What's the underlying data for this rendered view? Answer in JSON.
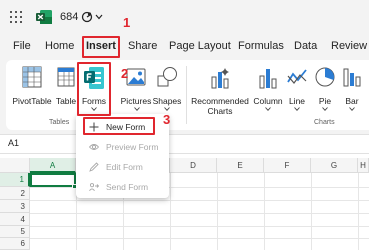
{
  "titlebar": {
    "doc_name": "684"
  },
  "tabs": [
    "File",
    "Home",
    "Insert",
    "Share",
    "Page Layout",
    "Formulas",
    "Data",
    "Review"
  ],
  "ribbon": {
    "pivottable": "PivotTable",
    "table": "Table",
    "forms": "Forms",
    "pictures": "Pictures",
    "shapes": "Shapes",
    "recommended_charts_1": "Recommended",
    "recommended_charts_2": "Charts",
    "column": "Column",
    "line": "Line",
    "pie": "Pie",
    "bar": "Bar",
    "group_tables": "Tables",
    "group_charts": "Charts"
  },
  "formula_bar": {
    "name_box": "A1"
  },
  "grid": {
    "columns": [
      "A",
      "B",
      "C",
      "D",
      "E",
      "F",
      "G",
      "H"
    ],
    "rows": [
      "1",
      "2",
      "3",
      "4",
      "5",
      "6"
    ]
  },
  "forms_menu": {
    "items": [
      "New Form",
      "Preview Form",
      "Edit Form",
      "Send Form"
    ]
  },
  "annotations": {
    "step1": "1",
    "step2": "2",
    "step3": "3"
  },
  "colors": {
    "accent": "#107c41",
    "annotation": "#e0262e"
  }
}
